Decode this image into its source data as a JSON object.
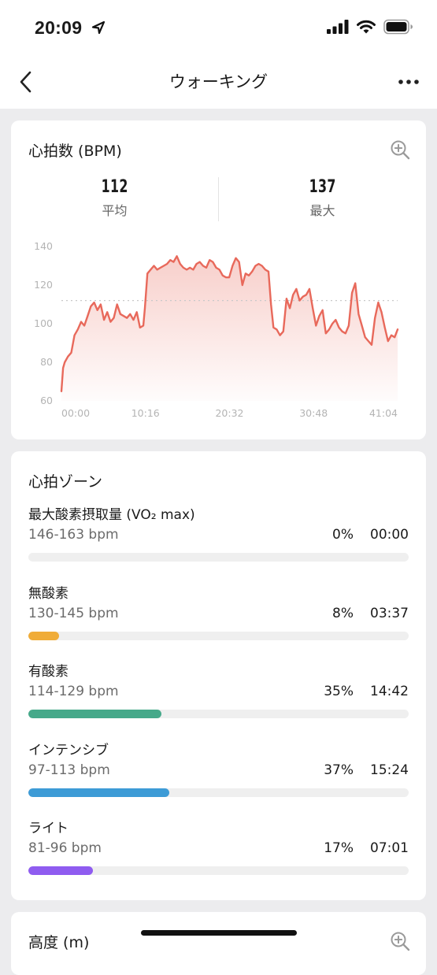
{
  "status": {
    "time": "20:09"
  },
  "nav": {
    "title": "ウォーキング"
  },
  "heart_rate": {
    "title": "心拍数 (BPM)",
    "avg_value": "112",
    "avg_label": "平均",
    "max_value": "137",
    "max_label": "最大"
  },
  "chart_data": {
    "type": "area",
    "xlabel": "",
    "ylabel": "",
    "x_ticks": [
      "00:00",
      "10:16",
      "20:32",
      "30:48",
      "41:04"
    ],
    "y_ticks": [
      60,
      80,
      100,
      120,
      140
    ],
    "ylim": [
      60,
      140
    ],
    "xlim": [
      0,
      41.07
    ],
    "reference_line": 112,
    "color": "#e8695b",
    "x": [
      0.0,
      0.2,
      0.4,
      0.8,
      1.2,
      1.6,
      2.0,
      2.4,
      2.8,
      3.2,
      3.6,
      4.0,
      4.4,
      4.8,
      5.2,
      5.6,
      6.0,
      6.4,
      6.8,
      7.2,
      7.6,
      8.0,
      8.4,
      8.8,
      9.2,
      9.6,
      10.0,
      10.2,
      10.5,
      10.9,
      11.3,
      11.7,
      12.1,
      12.5,
      12.9,
      13.3,
      13.7,
      14.1,
      14.5,
      14.9,
      15.3,
      15.7,
      16.1,
      16.5,
      16.9,
      17.3,
      17.7,
      18.1,
      18.5,
      18.9,
      19.3,
      19.7,
      20.1,
      20.5,
      20.9,
      21.3,
      21.7,
      22.1,
      22.5,
      22.9,
      23.3,
      23.7,
      24.1,
      24.5,
      24.9,
      25.3,
      25.6,
      25.9,
      26.3,
      26.7,
      27.1,
      27.5,
      27.9,
      28.3,
      28.7,
      29.1,
      29.5,
      29.9,
      30.3,
      30.7,
      31.1,
      31.5,
      31.9,
      32.3,
      32.7,
      33.1,
      33.5,
      33.9,
      34.3,
      34.7,
      35.1,
      35.5,
      35.9,
      36.3,
      36.7,
      37.1,
      37.5,
      37.9,
      38.3,
      38.7,
      39.1,
      39.5,
      39.9,
      40.3,
      40.7,
      41.07
    ],
    "y": [
      65,
      77,
      80,
      83,
      85,
      94,
      97,
      101,
      99,
      104,
      109,
      111,
      107,
      110,
      102,
      106,
      101,
      103,
      110,
      105,
      104,
      103,
      105,
      102,
      106,
      98,
      99,
      108,
      126,
      128,
      130,
      128,
      129,
      130,
      131,
      133,
      132,
      135,
      131,
      129,
      128,
      129,
      128,
      131,
      132,
      130,
      129,
      133,
      132,
      129,
      128,
      125,
      124,
      124,
      130,
      134,
      132,
      120,
      126,
      125,
      127,
      130,
      131,
      130,
      128,
      127,
      110,
      98,
      97,
      94,
      96,
      113,
      108,
      115,
      118,
      112,
      114,
      115,
      118,
      108,
      99,
      104,
      107,
      95,
      97,
      100,
      102,
      98,
      96,
      95,
      99,
      116,
      121,
      105,
      99,
      93,
      91,
      89,
      103,
      111,
      106,
      98,
      91,
      94,
      93,
      97
    ]
  },
  "zones": {
    "title": "心拍ゾーン",
    "items": [
      {
        "name": "最大酸素摂取量 (VO₂ max)",
        "range": "146-163 bpm",
        "percent": "0%",
        "duration": "00:00",
        "fraction": 0.0,
        "color": "#e05a4f"
      },
      {
        "name": "無酸素",
        "range": "130-145 bpm",
        "percent": "8%",
        "duration": "03:37",
        "fraction": 0.08,
        "color": "#f0ac38"
      },
      {
        "name": "有酸素",
        "range": "114-129 bpm",
        "percent": "35%",
        "duration": "14:42",
        "fraction": 0.35,
        "color": "#46a98a"
      },
      {
        "name": "インテンシブ",
        "range": "97-113 bpm",
        "percent": "37%",
        "duration": "15:24",
        "fraction": 0.37,
        "color": "#3d9bd6"
      },
      {
        "name": "ライト",
        "range": "81-96 bpm",
        "percent": "17%",
        "duration": "07:01",
        "fraction": 0.17,
        "color": "#8f5cf0"
      }
    ]
  },
  "altitude": {
    "title": "高度 (m)"
  }
}
